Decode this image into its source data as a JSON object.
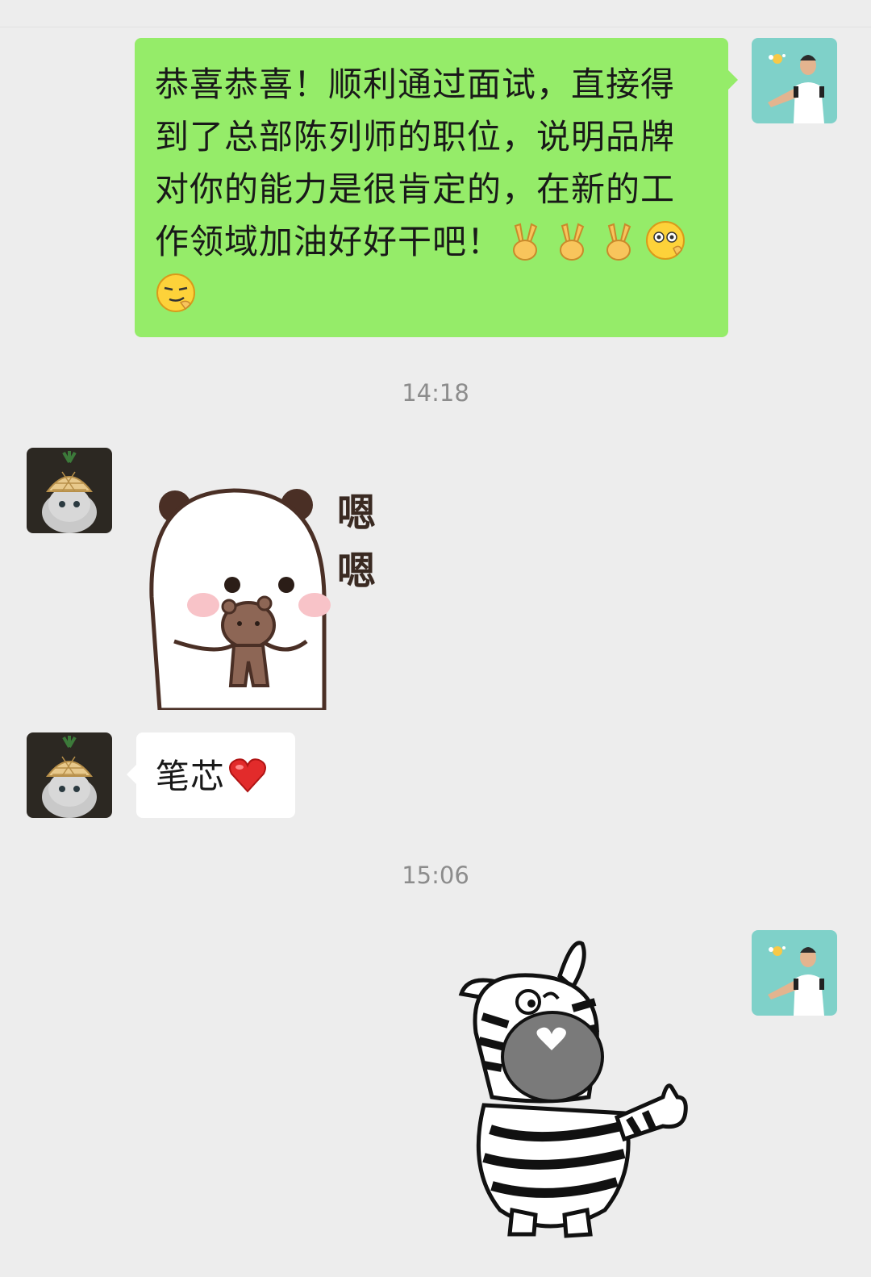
{
  "messages": [
    {
      "sender": "self",
      "type": "text",
      "text_line1": "恭喜恭喜！顺利通过面试，直接得",
      "text_line2": "到了总部陈列师的职位，说明品牌",
      "text_line3": "对你的能力是很肯定的，在新的工",
      "text_line4": "作领域加油好好干吧！",
      "emojis": [
        "victory-hand-icon",
        "victory-hand-icon",
        "victory-hand-icon",
        "flushed-face-icon",
        "smirk-face-icon"
      ]
    },
    {
      "type": "timestamp",
      "time": "14:18"
    },
    {
      "sender": "other",
      "type": "sticker",
      "sticker": "panda-hugging-bear-sticker",
      "sticker_text": [
        "嗯",
        "嗯"
      ]
    },
    {
      "sender": "other",
      "type": "text",
      "text": "笔芯",
      "emojis": [
        "red-heart-icon"
      ]
    },
    {
      "type": "timestamp",
      "time": "15:06"
    },
    {
      "sender": "self",
      "type": "sticker",
      "sticker": "zebra-thumbs-up-sticker"
    }
  ],
  "colors": {
    "background": "#ededed",
    "self_bubble": "#95ec69",
    "other_bubble": "#ffffff",
    "timestamp": "#8c8c8c"
  }
}
